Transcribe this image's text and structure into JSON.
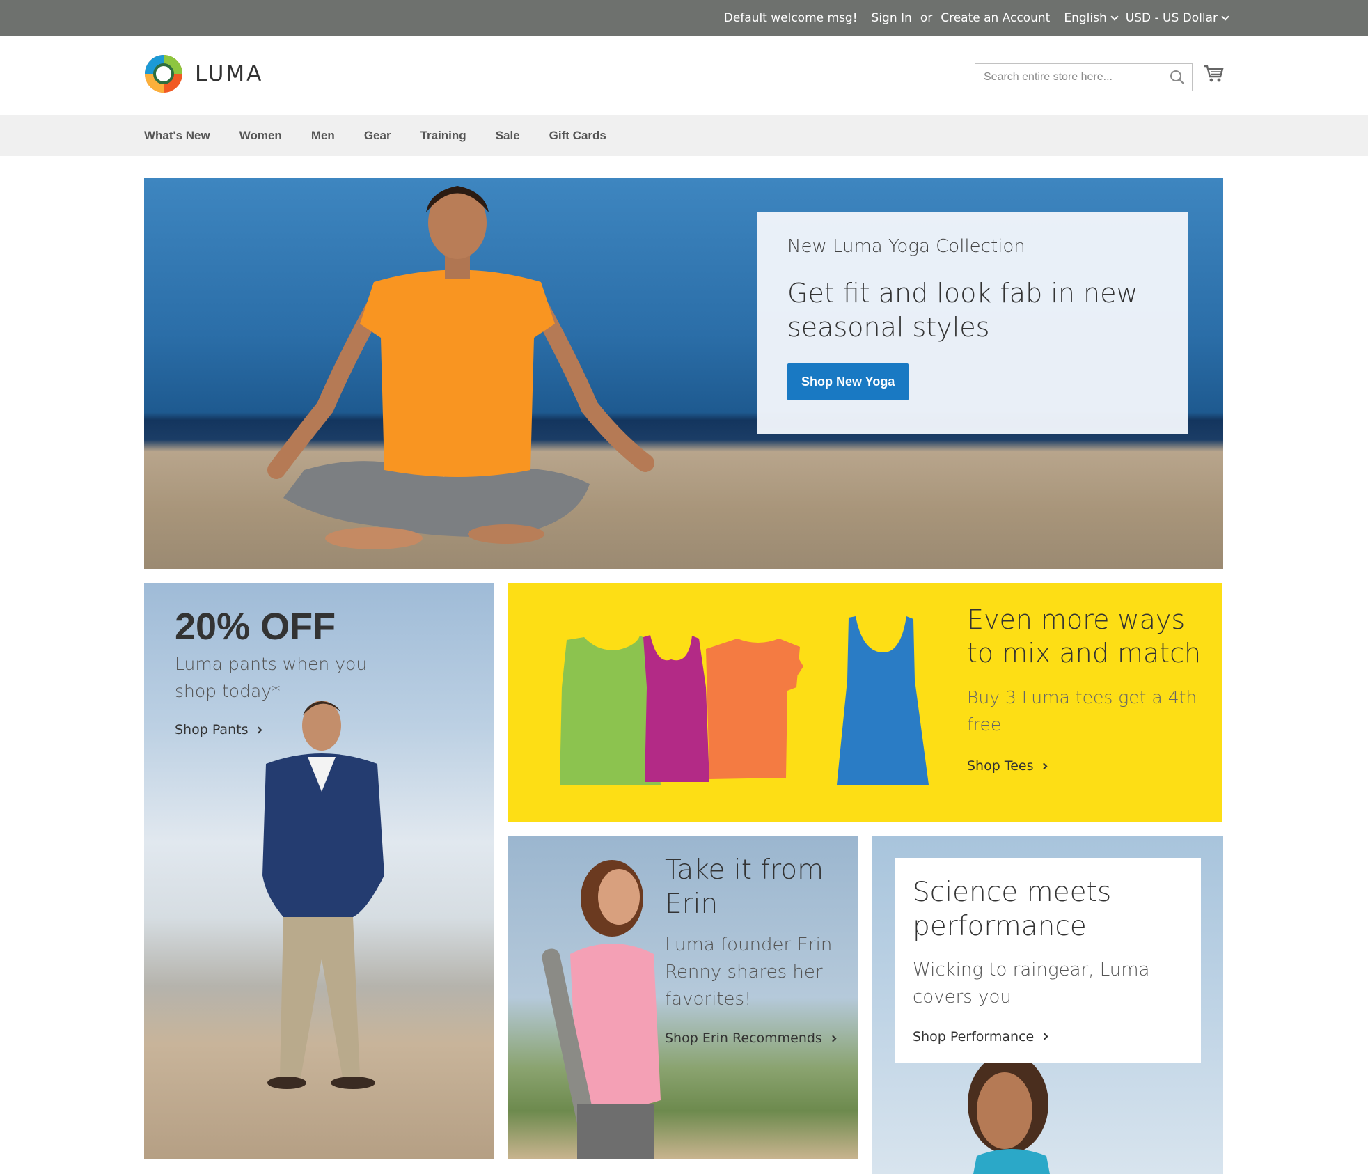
{
  "topbar": {
    "welcome": "Default welcome msg!",
    "sign_in": "Sign In",
    "or": "or",
    "create_account": "Create an Account",
    "language": "English",
    "currency": "USD - US Dollar"
  },
  "header": {
    "logo_text": "LUMA",
    "search_placeholder": "Search entire store here..."
  },
  "nav": {
    "items": [
      "What's New",
      "Women",
      "Men",
      "Gear",
      "Training",
      "Sale",
      "Gift Cards"
    ]
  },
  "hero": {
    "subtitle": "New Luma Yoga Collection",
    "title": "Get fit and look fab in new seasonal styles",
    "button": "Shop New Yoga"
  },
  "pants": {
    "headline": "20% OFF",
    "description": "Luma pants when you shop today*",
    "link": "Shop Pants"
  },
  "tees": {
    "headline": "Even more ways to mix and match",
    "description": "Buy 3 Luma tees get a 4th free",
    "link": "Shop Tees"
  },
  "erin": {
    "headline": "Take it from Erin",
    "description": "Luma founder Erin Renny shares her favorites!",
    "link": "Shop Erin Recommends"
  },
  "performance": {
    "headline": "Science meets performance",
    "description": "Wicking to raingear, Luma covers you",
    "link": "Shop Performance"
  },
  "colors": {
    "topbar": "#6e716e",
    "nav_bg": "#f0f0f0",
    "primary_button": "#1979c3",
    "tees_bg": "#fdde15",
    "tee_green": "#8cc34f",
    "tee_magenta": "#b32a86",
    "tee_orange": "#f47b42",
    "tee_blue": "#2a7cc5"
  },
  "icons": [
    "luma-logo-icon",
    "search-icon",
    "cart-icon",
    "chevron-down-icon",
    "chevron-right-icon"
  ]
}
